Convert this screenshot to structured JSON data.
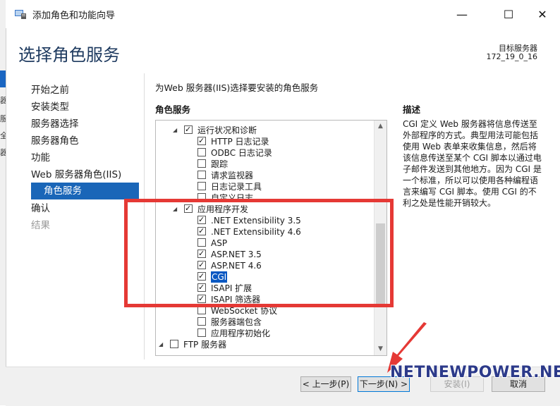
{
  "window": {
    "title": "添加角色和功能向导",
    "minimize_glyph": "—",
    "maximize_glyph": "☐",
    "close_glyph": "✕"
  },
  "desktop_strip": {
    "glyphs": [
      "器",
      "服",
      "全",
      "器"
    ]
  },
  "header": {
    "page_title": "选择角色服务",
    "dest_label": "目标服务器",
    "dest_value": "172_19_0_16"
  },
  "nav": {
    "items": [
      {
        "label": "开始之前",
        "state": "normal"
      },
      {
        "label": "安装类型",
        "state": "normal"
      },
      {
        "label": "服务器选择",
        "state": "normal"
      },
      {
        "label": "服务器角色",
        "state": "normal"
      },
      {
        "label": "功能",
        "state": "normal"
      },
      {
        "label": "Web 服务器角色(IIS)",
        "state": "normal"
      },
      {
        "label": "角色服务",
        "state": "active"
      },
      {
        "label": "确认",
        "state": "normal"
      },
      {
        "label": "结果",
        "state": "disabled"
      }
    ]
  },
  "main": {
    "description": "为Web 服务器(IIS)选择要安装的角色服务",
    "roles_header": "角色服务",
    "desc_header": "描述",
    "desc_text": "CGI 定义 Web 服务器将信息传送至外部程序的方式。典型用法可能包括使用 Web 表单来收集信息，然后将该信息传送至某个 CGI 脚本以通过电子邮件发送到其他地方。因为 CGI 是一个标准，所以可以使用各种编程语言来编写 CGI 脚本。使用 CGI 的不利之处是性能开销较大。",
    "tree": [
      {
        "label": "运行状况和诊断",
        "checked": true,
        "level": 1,
        "expander": "◢"
      },
      {
        "label": "HTTP 日志记录",
        "checked": true,
        "level": 2
      },
      {
        "label": "ODBC 日志记录",
        "checked": false,
        "level": 2
      },
      {
        "label": "跟踪",
        "checked": false,
        "level": 2
      },
      {
        "label": "请求监视器",
        "checked": false,
        "level": 2
      },
      {
        "label": "日志记录工具",
        "checked": false,
        "level": 2
      },
      {
        "label": "自定义日志",
        "checked": false,
        "level": 2
      },
      {
        "label": "应用程序开发",
        "checked": true,
        "level": 1,
        "expander": "◢"
      },
      {
        "label": ".NET Extensibility 3.5",
        "checked": true,
        "level": 2
      },
      {
        "label": ".NET Extensibility 4.6",
        "checked": true,
        "level": 2
      },
      {
        "label": "ASP",
        "checked": false,
        "level": 2
      },
      {
        "label": "ASP.NET 3.5",
        "checked": true,
        "level": 2
      },
      {
        "label": "ASP.NET 4.6",
        "checked": true,
        "level": 2
      },
      {
        "label": "CGI",
        "checked": true,
        "level": 2,
        "selected": true
      },
      {
        "label": "ISAPI 扩展",
        "checked": true,
        "level": 2
      },
      {
        "label": "ISAPI 筛选器",
        "checked": true,
        "level": 2
      },
      {
        "label": "WebSocket 协议",
        "checked": false,
        "level": 2
      },
      {
        "label": "服务器端包含",
        "checked": false,
        "level": 2
      },
      {
        "label": "应用程序初始化",
        "checked": false,
        "level": 2
      },
      {
        "label": "FTP 服务器",
        "checked": false,
        "level": 0,
        "expander": "◢"
      }
    ],
    "scroll_up": "▲",
    "scroll_down": "▼"
  },
  "buttons": {
    "prev": "< 上一步(P)",
    "next": "下一步(N) >",
    "install": "安装(I)",
    "cancel": "取消"
  },
  "watermark": "NETNEWPOWER.NET",
  "colors": {
    "accent": "#1a66b8",
    "highlight": "#e53935",
    "arrow": "#e53935"
  }
}
